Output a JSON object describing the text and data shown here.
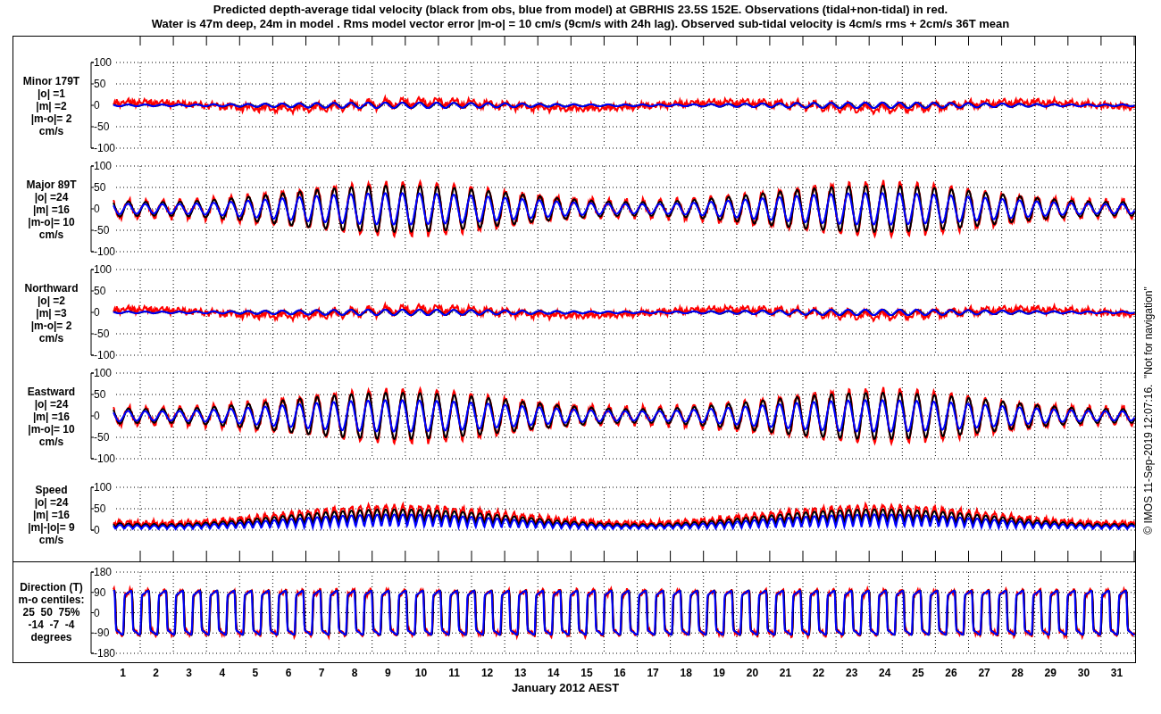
{
  "title": {
    "line_1": "Predicted depth-average tidal velocity (black from obs, blue from model) at GBRHIS 23.5S 152E. Observations (tidal+non-tidal) in red.",
    "line_2": "Water is 47m deep, 24m in model . Rms model vector error |m-o| = 10 cm/s (9cm/s with 24h lag). Observed sub-tidal velocity is 4cm/s rms + 2cm/s 36T mean"
  },
  "panels": [
    {
      "kind": "residual",
      "label_lines": [
        "Minor 179T",
        "|o| =1",
        "|m| =2",
        "|m-o|= 2",
        "cm/s"
      ],
      "y_ticks": [
        "100",
        "50",
        "0",
        "-50",
        "-100"
      ]
    },
    {
      "kind": "tidal",
      "label_lines": [
        "Major 89T",
        "|o| =24",
        "|m| =16",
        "|m-o|= 10",
        "cm/s"
      ],
      "y_ticks": [
        "100",
        "50",
        "0",
        "-50",
        "-100"
      ]
    },
    {
      "kind": "residual",
      "label_lines": [
        "Northward",
        "|o| =2",
        "|m| =3",
        "|m-o|= 2",
        "cm/s"
      ],
      "y_ticks": [
        "100",
        "50",
        "0",
        "-50",
        "-100"
      ]
    },
    {
      "kind": "tidal",
      "label_lines": [
        "Eastward",
        "|o| =24",
        "|m| =16",
        "|m-o|= 10",
        "cm/s"
      ],
      "y_ticks": [
        "100",
        "50",
        "0",
        "-50",
        "-100"
      ]
    },
    {
      "kind": "speed",
      "label_lines": [
        "Speed",
        "|o| =24",
        "|m| =16",
        "|m|-|o|= 9",
        "cm/s"
      ],
      "y_ticks": [
        "100",
        "50",
        "0"
      ]
    },
    {
      "kind": "direction",
      "label_lines": [
        "Direction (T)",
        "m-o centiles:",
        "25  50  75%",
        "-14  -7  -4",
        "degrees"
      ],
      "y_ticks": [
        "180",
        "90",
        "0",
        "-90",
        "-180"
      ]
    }
  ],
  "x_axis": {
    "day_labels": [
      "1",
      "2",
      "3",
      "4",
      "5",
      "6",
      "7",
      "8",
      "9",
      "10",
      "11",
      "12",
      "13",
      "14",
      "15",
      "16",
      "17",
      "18",
      "19",
      "20",
      "21",
      "22",
      "23",
      "24",
      "25",
      "26",
      "27",
      "28",
      "29",
      "30",
      "31"
    ],
    "label": "January 2012 AEST"
  },
  "credit": "© IMOS 11-Sep-2019 12:07:16.  \"Not for navigation\""
}
